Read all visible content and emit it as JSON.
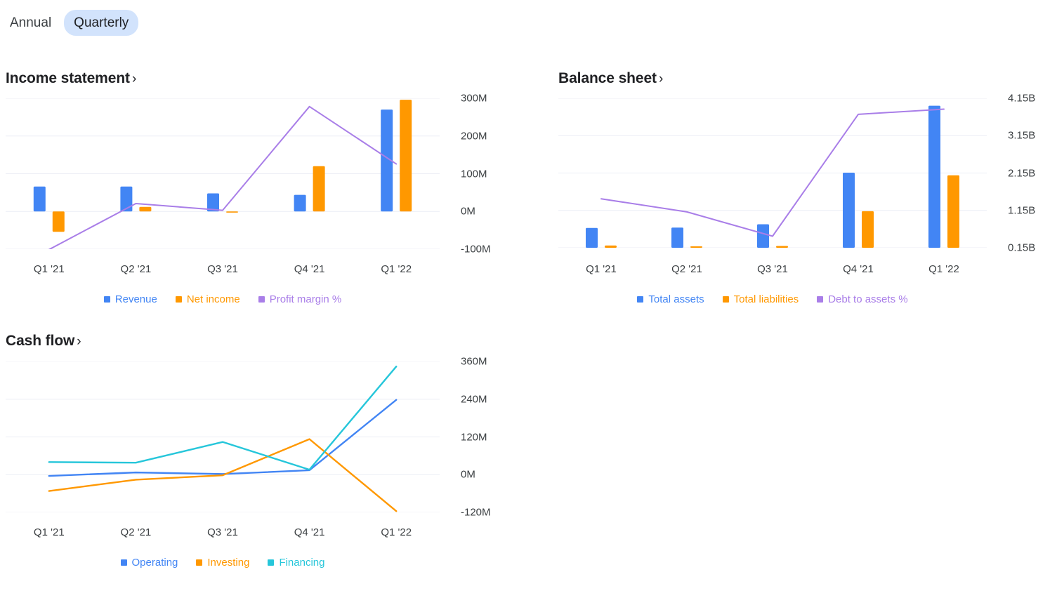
{
  "period_toggle": {
    "options": [
      {
        "label": "Annual",
        "active": false
      },
      {
        "label": "Quarterly",
        "active": true
      }
    ]
  },
  "colors": {
    "blue": "#4285f4",
    "orange": "#ff9800",
    "purple": "#a97ee8",
    "teal": "#26c6da",
    "grid": "#eceef5",
    "text": "#3c4043"
  },
  "sections": {
    "income": {
      "title": "Income statement",
      "chevron": "›"
    },
    "balance": {
      "title": "Balance sheet",
      "chevron": "›"
    },
    "cashflow": {
      "title": "Cash flow",
      "chevron": "›"
    }
  },
  "chart_data": [
    {
      "id": "income-statement",
      "type": "bar",
      "title": "Income statement",
      "xlabel": "",
      "ylabel": "",
      "grid": true,
      "legend_position": "bottom",
      "categories": [
        "Q1 '21",
        "Q2 '21",
        "Q3 '21",
        "Q4 '21",
        "Q1 '22"
      ],
      "ylim": [
        -100,
        300
      ],
      "yticks": [
        300,
        200,
        100,
        0,
        -100
      ],
      "ytick_labels": [
        "300M",
        "200M",
        "100M",
        "0M",
        "-100M"
      ],
      "series": [
        {
          "name": "Revenue",
          "kind": "bar",
          "color": "#4285f4",
          "values": [
            66,
            66,
            48,
            44,
            270
          ]
        },
        {
          "name": "Net income",
          "kind": "bar",
          "color": "#ff9800",
          "values": [
            -54,
            12,
            -3,
            120,
            296
          ]
        },
        {
          "name": "Profit margin %",
          "kind": "line",
          "color": "#a97ee8",
          "values": [
            -101,
            21,
            3,
            278,
            126
          ]
        }
      ]
    },
    {
      "id": "balance-sheet",
      "type": "bar",
      "title": "Balance sheet",
      "xlabel": "",
      "ylabel": "",
      "grid": true,
      "legend_position": "bottom",
      "categories": [
        "Q1 '21",
        "Q2 '21",
        "Q3 '21",
        "Q4 '21",
        "Q1 '22"
      ],
      "ylim": [
        0.15,
        4.15
      ],
      "yticks": [
        4.15,
        3.15,
        2.15,
        1.15,
        0.15
      ],
      "ytick_labels": [
        "4.15B",
        "3.15B",
        "2.15B",
        "1.15B",
        "0.15B"
      ],
      "series": [
        {
          "name": "Total assets",
          "kind": "bar",
          "color": "#4285f4",
          "values": [
            0.68,
            0.69,
            0.78,
            2.16,
            3.95
          ]
        },
        {
          "name": "Total liabilities",
          "kind": "bar",
          "color": "#ff9800",
          "values": [
            0.21,
            0.19,
            0.2,
            1.13,
            2.09
          ]
        },
        {
          "name": "Debt to assets %",
          "kind": "line",
          "color": "#a97ee8",
          "values": [
            1.46,
            1.11,
            0.46,
            3.72,
            3.86
          ]
        }
      ]
    },
    {
      "id": "cash-flow",
      "type": "line",
      "title": "Cash flow",
      "xlabel": "",
      "ylabel": "",
      "grid": true,
      "legend_position": "bottom",
      "categories": [
        "Q1 '21",
        "Q2 '21",
        "Q3 '21",
        "Q4 '21",
        "Q1 '22"
      ],
      "ylim": [
        -120,
        360
      ],
      "yticks": [
        360,
        240,
        120,
        0,
        -120
      ],
      "ytick_labels": [
        "360M",
        "240M",
        "120M",
        "0M",
        "-120M"
      ],
      "series": [
        {
          "name": "Operating",
          "kind": "line",
          "color": "#4285f4",
          "values": [
            -4,
            7,
            2,
            14,
            238
          ]
        },
        {
          "name": "Investing",
          "kind": "line",
          "color": "#ff9800",
          "values": [
            -52,
            -16,
            -2,
            113,
            -116
          ]
        },
        {
          "name": "Financing",
          "kind": "line",
          "color": "#26c6da",
          "values": [
            40,
            38,
            104,
            16,
            344
          ]
        }
      ]
    }
  ]
}
